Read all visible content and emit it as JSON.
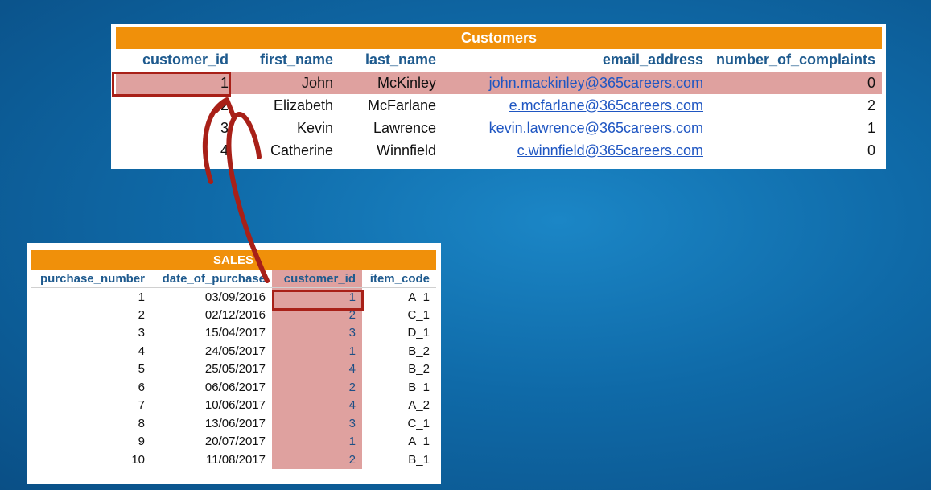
{
  "customers": {
    "title": "Customers",
    "columns": [
      "customer_id",
      "first_name",
      "last_name",
      "email_address",
      "number_of_complaints"
    ],
    "rows": [
      [
        "1",
        "John",
        "McKinley",
        "john.mackinley@365careers.com",
        "0"
      ],
      [
        "2",
        "Elizabeth",
        "McFarlane",
        "e.mcfarlane@365careers.com",
        "2"
      ],
      [
        "3",
        "Kevin",
        "Lawrence",
        "kevin.lawrence@365careers.com",
        "1"
      ],
      [
        "4",
        "Catherine",
        "Winnfield",
        "c.winnfield@365careers.com",
        "0"
      ]
    ]
  },
  "sales": {
    "title": "SALES",
    "columns": [
      "purchase_number",
      "date_of_purchase",
      "customer_id",
      "item_code"
    ],
    "rows": [
      [
        "1",
        "03/09/2016",
        "1",
        "A_1"
      ],
      [
        "2",
        "02/12/2016",
        "2",
        "C_1"
      ],
      [
        "3",
        "15/04/2017",
        "3",
        "D_1"
      ],
      [
        "4",
        "24/05/2017",
        "1",
        "B_2"
      ],
      [
        "5",
        "25/05/2017",
        "4",
        "B_2"
      ],
      [
        "6",
        "06/06/2017",
        "2",
        "B_1"
      ],
      [
        "7",
        "10/06/2017",
        "4",
        "A_2"
      ],
      [
        "8",
        "13/06/2017",
        "3",
        "C_1"
      ],
      [
        "9",
        "20/07/2017",
        "1",
        "A_1"
      ],
      [
        "10",
        "11/08/2017",
        "2",
        "B_1"
      ]
    ]
  },
  "colors": {
    "header_orange": "#f0900a",
    "highlight_pink": "#dfa19f",
    "highlight_border": "#a82018",
    "column_header_blue": "#1e5a8e",
    "link_blue": "#1f56c2"
  },
  "icons": [
    "curved-arrow-icon"
  ]
}
